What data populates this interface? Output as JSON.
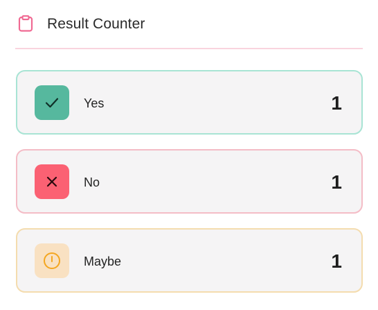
{
  "header": {
    "title": "Result Counter",
    "icon": "clipboard-icon"
  },
  "results": [
    {
      "key": "yes",
      "label": "Yes",
      "count": "1",
      "icon": "check-icon"
    },
    {
      "key": "no",
      "label": "No",
      "count": "1",
      "icon": "x-icon"
    },
    {
      "key": "maybe",
      "label": "Maybe",
      "count": "1",
      "icon": "clock-icon"
    }
  ],
  "colors": {
    "accent": "#f06a93",
    "yes": "#56b89e",
    "no": "#fb6173",
    "maybe": "#f4a620"
  }
}
